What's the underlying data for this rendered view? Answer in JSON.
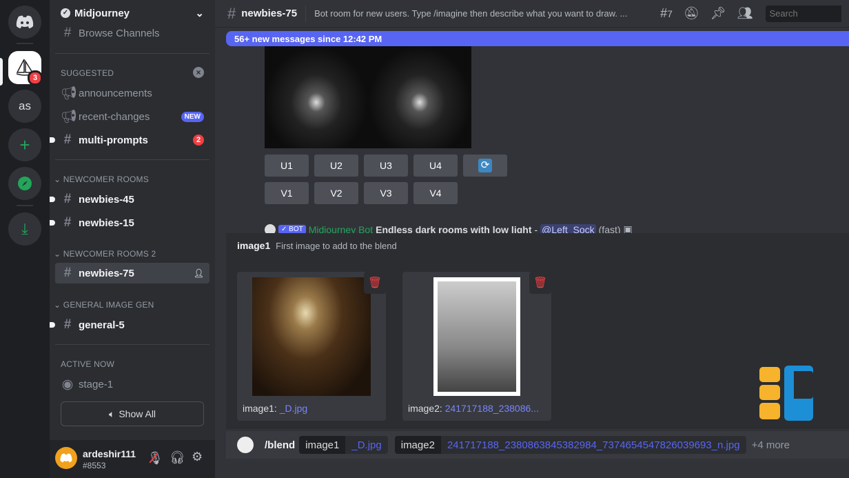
{
  "server_rail": {
    "badge": "3",
    "user_server": "as"
  },
  "sidebar": {
    "server_name": "Midjourney",
    "browse": "Browse Channels",
    "suggested": "SUGGESTED",
    "items": [
      {
        "label": "announcements"
      },
      {
        "label": "recent-changes",
        "badge": "NEW"
      },
      {
        "label": "multi-prompts",
        "badge": "2"
      }
    ],
    "cat1": "NEWCOMER ROOMS",
    "cat1_items": [
      "newbies-45",
      "newbies-15"
    ],
    "cat2": "NEWCOMER ROOMS 2",
    "cat2_items": [
      "newbies-75"
    ],
    "cat3": "GENERAL IMAGE GEN",
    "cat3_items": [
      "general-5"
    ],
    "active_now": "ACTIVE NOW",
    "stage": "stage-1",
    "show_all": "Show All"
  },
  "user": {
    "name": "ardeshir111",
    "tag": "#8553"
  },
  "header": {
    "channel": "newbies-75",
    "topic": "Bot room for new users. Type /imagine then describe what you want to draw. ...",
    "threads": "7",
    "search_placeholder": "Search"
  },
  "new_messages": "56+ new messages since 12:42 PM",
  "buttons": {
    "u": [
      "U1",
      "U2",
      "U3",
      "U4"
    ],
    "v": [
      "V1",
      "V2",
      "V3",
      "V4"
    ]
  },
  "message": {
    "bot_tag": "✓ BOT",
    "author": "Midjourney Bot",
    "text": "Endless dark rooms with low light",
    "sep": " - ",
    "mention": "@Left_Sock",
    "speed": "(fast)"
  },
  "options": {
    "name": "image1",
    "description": "First image to add to the blend",
    "cards": [
      {
        "label": "image1:",
        "file": "_D.jpg"
      },
      {
        "label": "image2:",
        "file": "241717188_238086..."
      }
    ]
  },
  "command": {
    "name": "/blend",
    "params": [
      {
        "key": "image1",
        "value": "_D.jpg"
      },
      {
        "key": "image2",
        "value": "241717188_2380863845382984_7374654547826039693_n.jpg"
      }
    ],
    "more": "+4 more"
  },
  "colors": {
    "accent": "#5865f2",
    "bot_name": "#23a55a",
    "danger": "#f23f43"
  }
}
